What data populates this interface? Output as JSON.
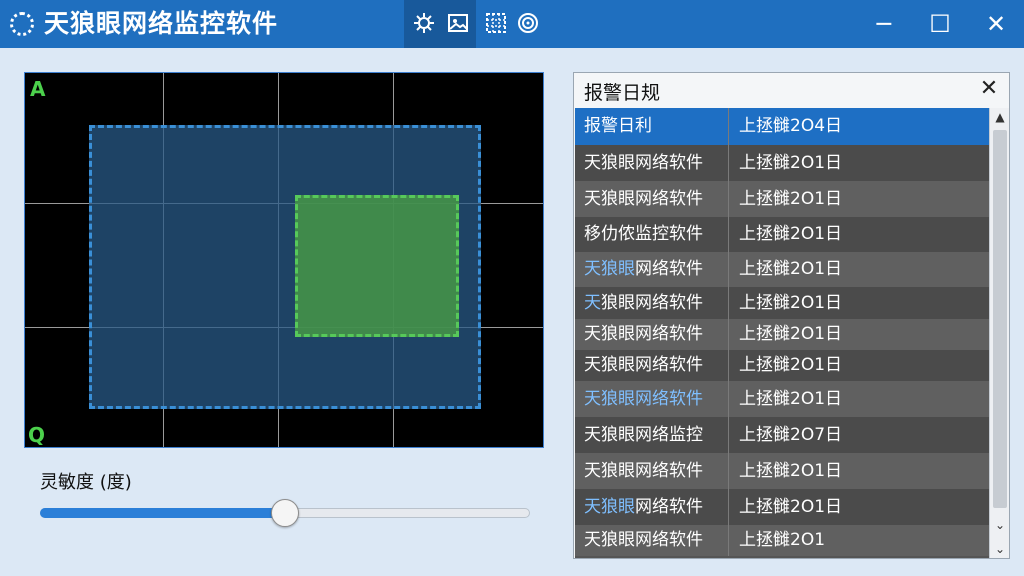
{
  "titlebar": {
    "title": "天狼眼网络监控软件",
    "app_icon": "app-logo-icon",
    "tools": [
      "settings-icon",
      "gallery-icon",
      "grid-icon",
      "target-icon"
    ],
    "minimize": "─",
    "maximize": "☐",
    "close": "✕"
  },
  "camera": {
    "corner_top": "A",
    "corner_bottom": "Q"
  },
  "sensitivity": {
    "label": "灵敏度 (度)",
    "value_percent": 50
  },
  "log": {
    "title": "报警日规",
    "close": "✕",
    "rows": [
      {
        "name": "报警日利",
        "time": "上拯雠2O4日"
      },
      {
        "name": "天狼眼网络软件",
        "time": "上拯雠2O1日"
      },
      {
        "name": "天狼眼网络软件",
        "time": "上拯雠2O1日"
      },
      {
        "name": "移仂侬监控软件",
        "time": "上拯雠2O1日"
      },
      {
        "name_hl": "天狼眼",
        "name": "网络软件",
        "time": "上拯雠2O1日"
      },
      {
        "name_hl": "天",
        "name": "狼眼网络软件",
        "time": "上拯雠2O1日"
      },
      {
        "name": "天狼眼网络软件",
        "time": "上拯雠2O1日"
      },
      {
        "name": "天狼眼网络软件",
        "time": "上拯雠2O1日"
      },
      {
        "name_hl": "天狼眼网络软件",
        "name": "",
        "time": "上拯雠2O1日"
      },
      {
        "name": "天狼眼网络监控",
        "time": "上拯雠2O7日"
      },
      {
        "name": "天狼眼网络软件",
        "time": "上拯雠2O1日"
      },
      {
        "name_hl": "天狼眼",
        "name": "网络软件",
        "time": "上拯雠2O1日"
      },
      {
        "name": "天狼眼网络软件",
        "time": "上拯雠2O1"
      }
    ]
  },
  "colors": {
    "titlebar": "#1f6fbf",
    "selected_row": "#1e6fc4",
    "zone_blue": "#3a8fd6",
    "zone_green": "#57c95a"
  }
}
